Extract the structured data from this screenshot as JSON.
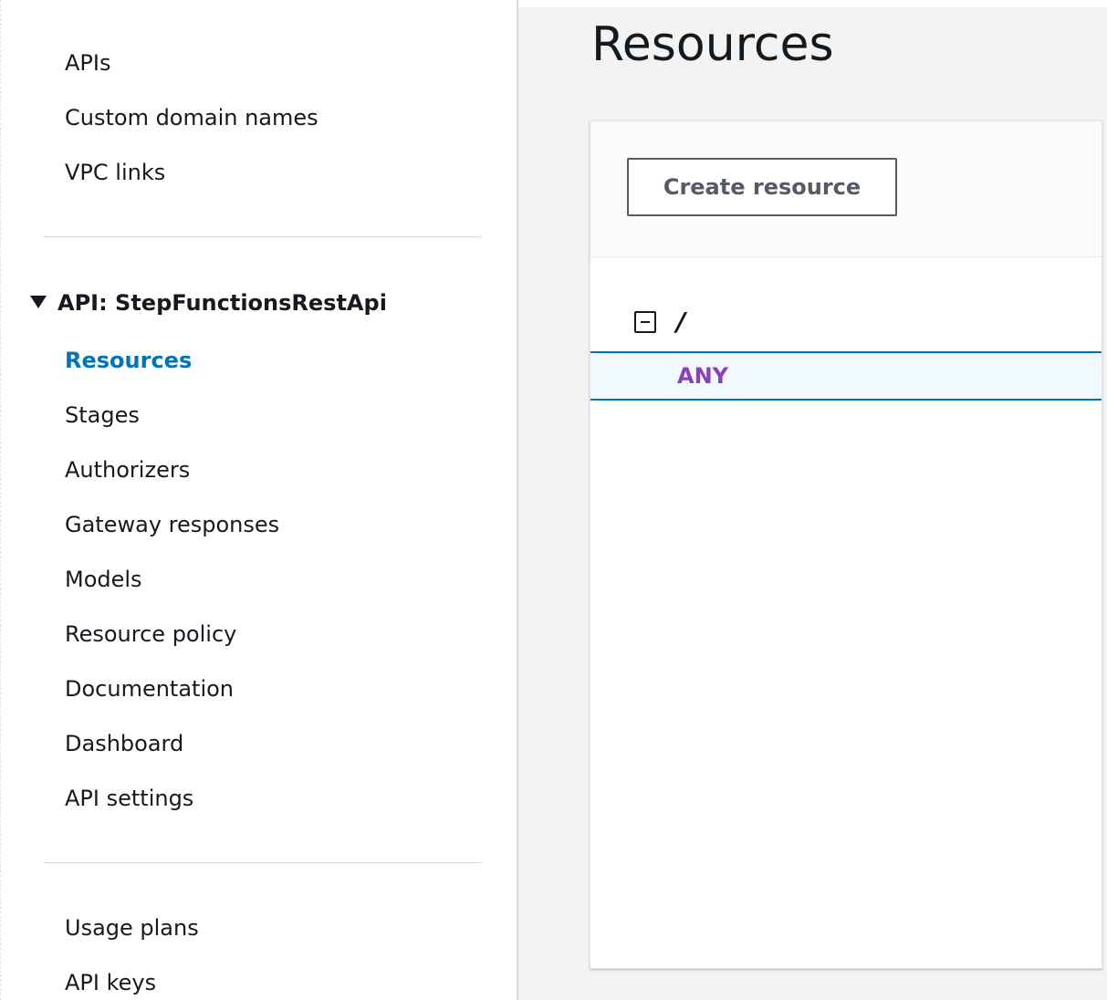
{
  "sidebar": {
    "top_items": [
      {
        "label": "APIs"
      },
      {
        "label": "Custom domain names"
      },
      {
        "label": "VPC links"
      }
    ],
    "api_section": {
      "header": "API: StepFunctionsRestApi",
      "items": [
        {
          "label": "Resources",
          "active": true
        },
        {
          "label": "Stages"
        },
        {
          "label": "Authorizers"
        },
        {
          "label": "Gateway responses"
        },
        {
          "label": "Models"
        },
        {
          "label": "Resource policy"
        },
        {
          "label": "Documentation"
        },
        {
          "label": "Dashboard"
        },
        {
          "label": "API settings"
        }
      ]
    },
    "bottom_items": [
      {
        "label": "Usage plans"
      },
      {
        "label": "API keys"
      }
    ]
  },
  "main": {
    "title": "Resources",
    "create_button_label": "Create resource",
    "tree": {
      "root_path": "/",
      "methods": [
        {
          "label": "ANY",
          "selected": true
        }
      ]
    }
  },
  "colors": {
    "active_nav": "#0073bb",
    "method_any": "#8a3fbf",
    "selected_row_bg": "#f1faff",
    "selected_row_border": "#0073bb"
  }
}
